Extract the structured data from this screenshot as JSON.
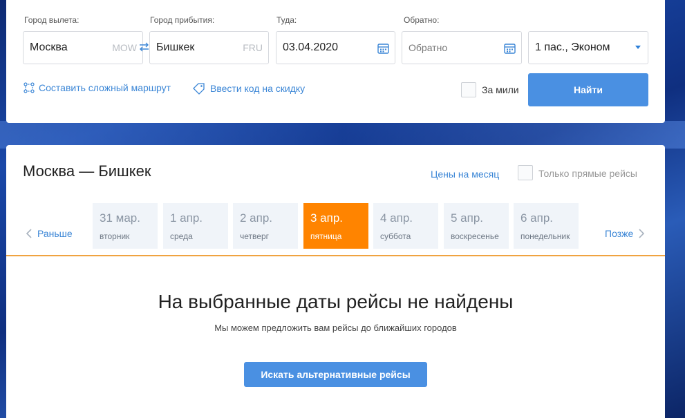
{
  "search": {
    "from_label": "Город вылета:",
    "from_value": "Москва",
    "from_code": "MOW",
    "to_label": "Город прибытия:",
    "to_value": "Бишкек",
    "to_code": "FRU",
    "depart_label": "Туда:",
    "depart_value": "03.04.2020",
    "return_label": "Обратно:",
    "return_placeholder": "Обратно",
    "passengers_value": "1 пас., Эконом",
    "complex_route_link": "Составить сложный маршрут",
    "discount_code_link": "Ввести код на скидку",
    "miles_label": "За мили",
    "find_button": "Найти"
  },
  "results": {
    "route_title": "Москва — Бишкек",
    "month_prices_link": "Цены на месяц",
    "direct_only_label": "Только прямые рейсы",
    "earlier": "Раньше",
    "later": "Позже",
    "days": [
      {
        "date": "31 мар.",
        "weekday": "вторник"
      },
      {
        "date": "1 апр.",
        "weekday": "среда"
      },
      {
        "date": "2 апр.",
        "weekday": "четверг"
      },
      {
        "date": "3 апр.",
        "weekday": "пятница"
      },
      {
        "date": "4 апр.",
        "weekday": "суббота"
      },
      {
        "date": "5 апр.",
        "weekday": "воскресенье"
      },
      {
        "date": "6 апр.",
        "weekday": "понедельник"
      }
    ],
    "selected_day_index": 3,
    "empty_title": "На выбранные даты рейсы не найдены",
    "empty_subtitle": "Мы можем предложить вам рейсы до ближайших городов",
    "alternative_button": "Искать альтернативные рейсы"
  },
  "colors": {
    "accent_blue": "#4a90e2",
    "link_blue": "#3b86d6",
    "selected_orange": "#ff8400"
  }
}
